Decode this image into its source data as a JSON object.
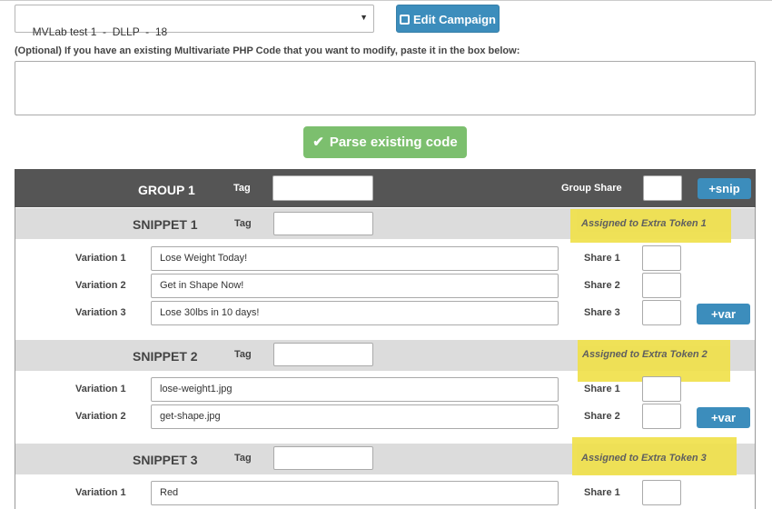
{
  "campaign_select": {
    "value": "MVLab test 1  -  DLLP  -  18"
  },
  "edit_campaign": {
    "label": "Edit Campaign"
  },
  "optional_label": "(Optional) If you have an existing Multivariate PHP Code that you want to modify, paste it in the box below:",
  "parse_button": {
    "label": "Parse existing code"
  },
  "group": {
    "title": "GROUP 1",
    "tag_label": "Tag",
    "share_label": "Group Share",
    "add_snip": "+snip"
  },
  "snippets": [
    {
      "title": "SNIPPET 1",
      "tag_label": "Tag",
      "token": "Assigned to Extra Token 1",
      "variations": [
        {
          "label": "Variation 1",
          "value": "Lose Weight Today!",
          "share_label": "Share 1"
        },
        {
          "label": "Variation 2",
          "value": "Get in Shape Now!",
          "share_label": "Share 2"
        },
        {
          "label": "Variation 3",
          "value": "Lose 30lbs in 10 days!",
          "share_label": "Share 3"
        }
      ],
      "add_var": "+var"
    },
    {
      "title": "SNIPPET 2",
      "tag_label": "Tag",
      "token": "Assigned to Extra Token 2",
      "variations": [
        {
          "label": "Variation 1",
          "value": "lose-weight1.jpg",
          "share_label": "Share 1"
        },
        {
          "label": "Variation 2",
          "value": "get-shape.jpg",
          "share_label": "Share 2"
        }
      ],
      "add_var": "+var"
    },
    {
      "title": "SNIPPET 3",
      "tag_label": "Tag",
      "token": "Assigned to Extra Token 3",
      "variations": [
        {
          "label": "Variation 1",
          "value": "Red",
          "share_label": "Share 1"
        }
      ]
    }
  ],
  "colors": {
    "primary_button": "#3c8dbc",
    "success_button": "#7cbf6e",
    "group_header": "#555555",
    "snippet_header": "#dcdcdc",
    "highlight": "#f0e14b"
  }
}
